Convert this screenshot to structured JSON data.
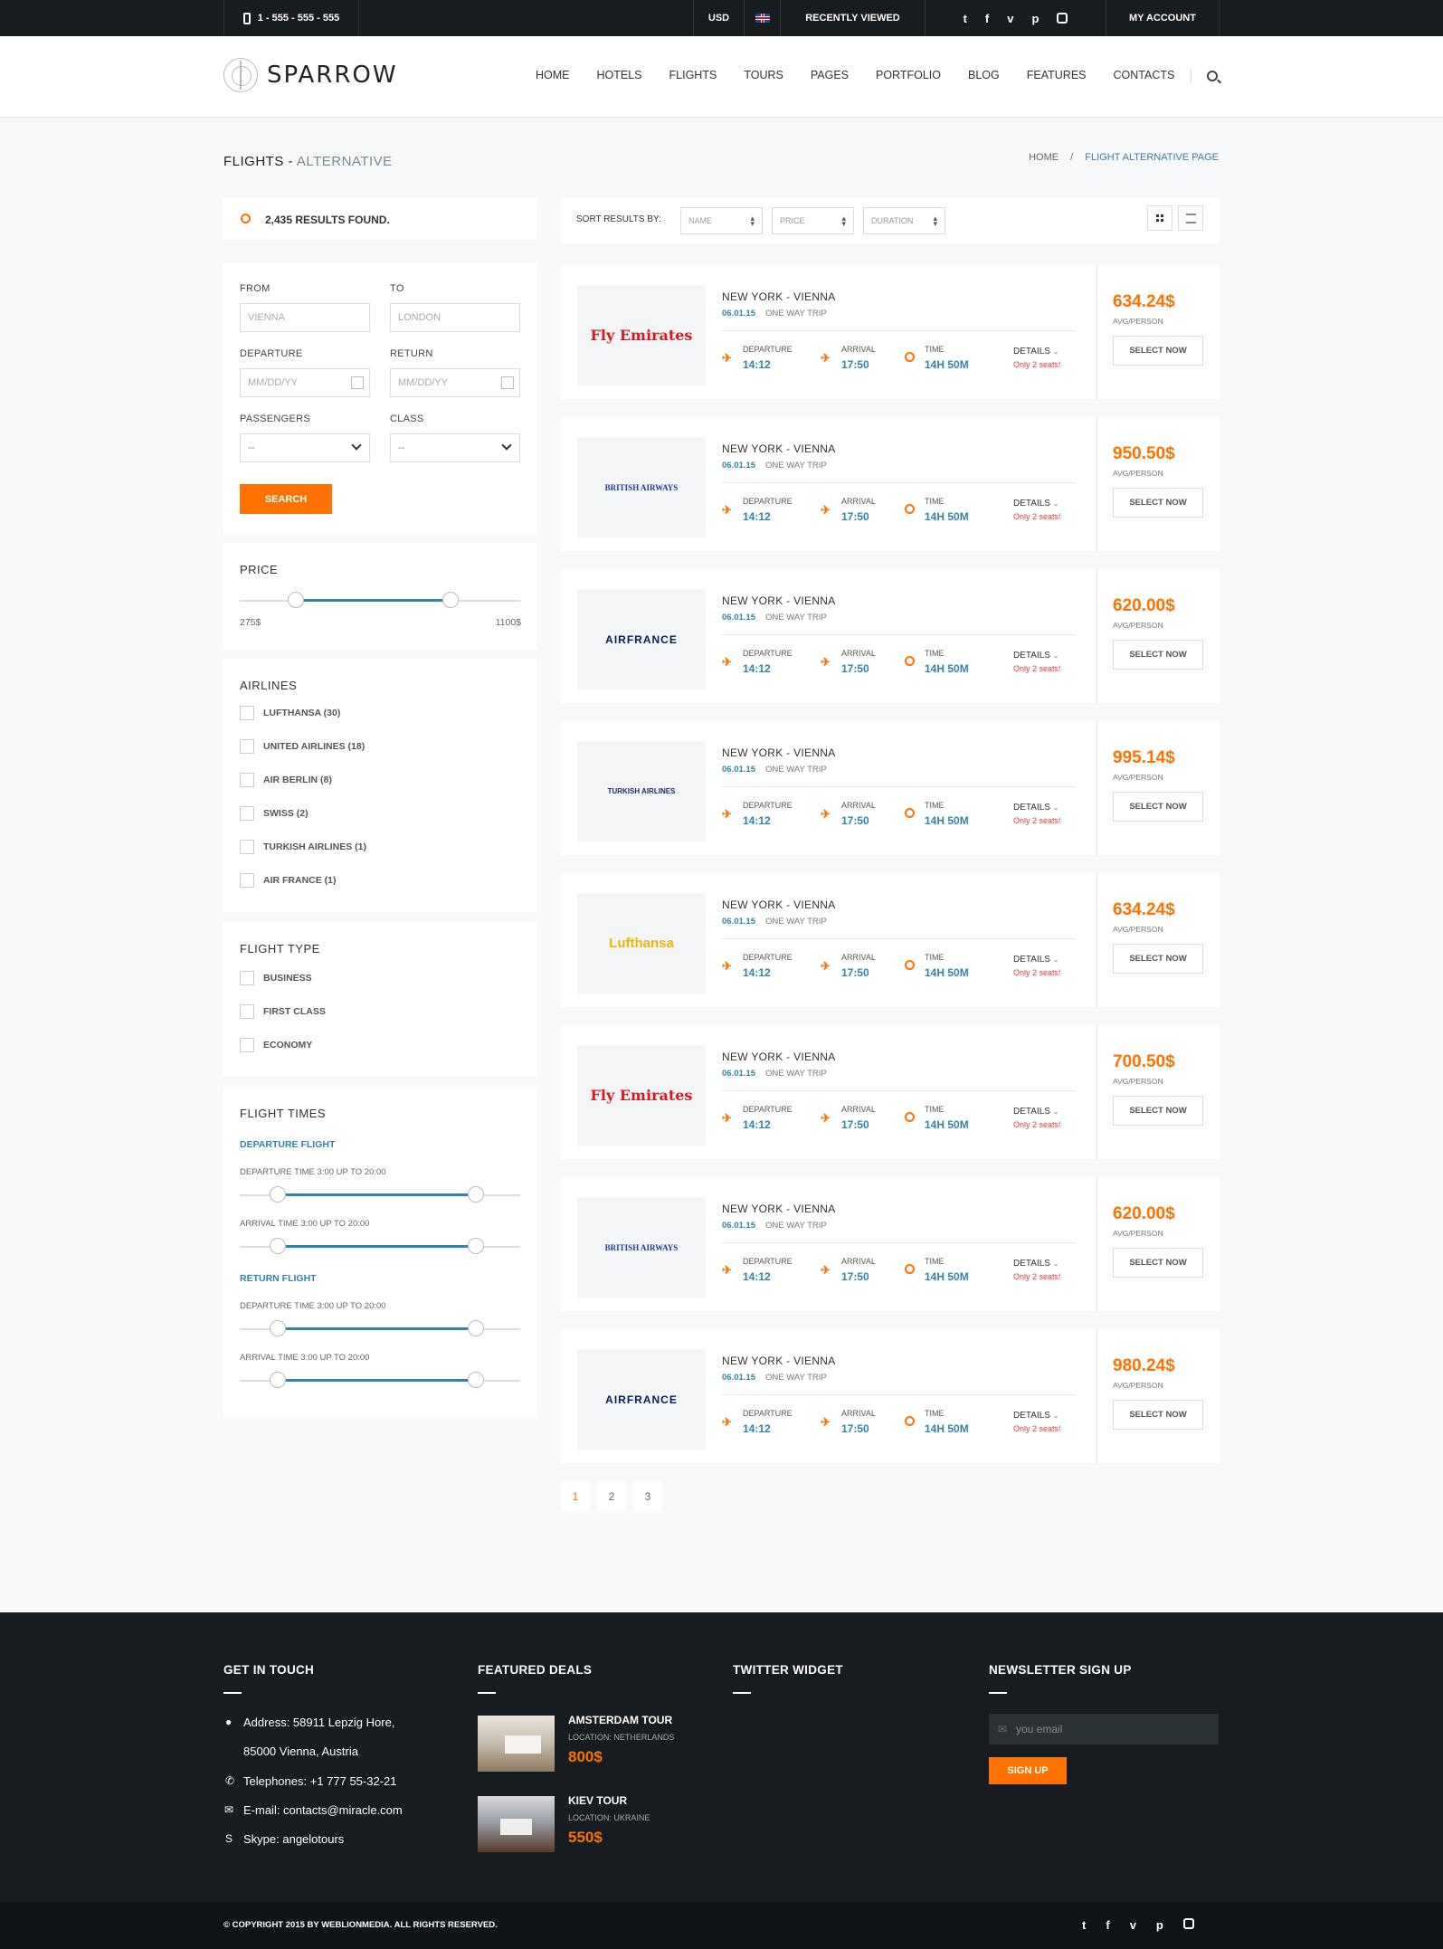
{
  "topbar": {
    "phone": "1 - 555 - 555 - 555",
    "currency": "USD",
    "recently_viewed": "RECENTLY VIEWED",
    "social": [
      "twitter-icon",
      "facebook-icon",
      "vimeo-icon",
      "pinterest-icon",
      "instagram-icon"
    ],
    "account": "MY ACCOUNT"
  },
  "header": {
    "brand": "SPARROW",
    "nav": [
      "HOME",
      "HOTELS",
      "FLIGHTS",
      "TOURS",
      "PAGES",
      "PORTFOLIO",
      "BLOG",
      "FEATURES",
      "CONTACTS"
    ]
  },
  "page": {
    "title_main": "FLIGHTS -",
    "title_alt": "ALTERNATIVE",
    "breadcrumb_home": "HOME",
    "breadcrumb_sep": "/",
    "breadcrumb_current": "FLIGHT ALTERNATIVE PAGE"
  },
  "results": {
    "count_text": "2,435 RESULTS FOUND."
  },
  "search_form": {
    "from_label": "FROM",
    "from_placeholder": "VIENNA",
    "to_label": "TO",
    "to_placeholder": "LONDON",
    "departure_label": "DEPARTURE",
    "departure_placeholder": "MM/DD/YY",
    "return_label": "RETURN",
    "return_placeholder": "MM/DD/YY",
    "passengers_label": "PASSENGERS",
    "passengers_value": "--",
    "class_label": "CLASS",
    "class_value": "--",
    "search_button": "SEARCH"
  },
  "price_filter": {
    "title": "PRICE",
    "min": "275$",
    "max": "1100$",
    "range_start_pct": 20,
    "range_end_pct": 75
  },
  "airlines_filter": {
    "title": "AIRLINES",
    "items": [
      "LUFTHANSA (30)",
      "UNITED AIRLINES (18)",
      "AIR BERLIN (8)",
      "SWISS (2)",
      "TURKISH AIRLINES (1)",
      "AIR FRANCE (1)"
    ]
  },
  "flight_type_filter": {
    "title": "FLIGHT TYPE",
    "items": [
      "BUSINESS",
      "FIRST CLASS",
      "ECONOMY"
    ]
  },
  "flight_times": {
    "title": "FLIGHT TIMES",
    "departure_flight": "DEPARTURE FLIGHT",
    "return_flight": "RETURN FLIGHT",
    "departure_time": "DEPARTURE TIME 3:00 UP TO 20:00",
    "arrival_time": "ARRIVAL TIME 3:00 UP TO 20:00"
  },
  "sort": {
    "label": "SORT RESULTS BY:",
    "options": [
      "NAME",
      "PRICE",
      "DURATION"
    ]
  },
  "flights": [
    {
      "airline": "Fly Emirates",
      "route": "NEW YORK - VIENNA",
      "date": "06.01.15",
      "trip": "ONE WAY TRIP",
      "departure": "14:12",
      "arrival": "17:50",
      "time": "14H 50M",
      "seats": "Only 2 seats!",
      "price": "634.24$"
    },
    {
      "airline": "BRITISH AIRWAYS",
      "route": "NEW YORK - VIENNA",
      "date": "06.01.15",
      "trip": "ONE WAY TRIP",
      "departure": "14:12",
      "arrival": "17:50",
      "time": "14H 50M",
      "seats": "Only 2 seats!",
      "price": "950.50$"
    },
    {
      "airline": "AIRFRANCE",
      "route": "NEW YORK - VIENNA",
      "date": "06.01.15",
      "trip": "ONE WAY TRIP",
      "departure": "14:12",
      "arrival": "17:50",
      "time": "14H 50M",
      "seats": "Only 2 seats!",
      "price": "620.00$"
    },
    {
      "airline": "TURKISH AIRLINES",
      "route": "NEW YORK - VIENNA",
      "date": "06.01.15",
      "trip": "ONE WAY TRIP",
      "departure": "14:12",
      "arrival": "17:50",
      "time": "14H 50M",
      "seats": "Only 2 seats!",
      "price": "995.14$"
    },
    {
      "airline": "Lufthansa",
      "route": "NEW YORK - VIENNA",
      "date": "06.01.15",
      "trip": "ONE WAY TRIP",
      "departure": "14:12",
      "arrival": "17:50",
      "time": "14H 50M",
      "seats": "Only 2 seats!",
      "price": "634.24$"
    },
    {
      "airline": "Fly Emirates",
      "route": "NEW YORK - VIENNA",
      "date": "06.01.15",
      "trip": "ONE WAY TRIP",
      "departure": "14:12",
      "arrival": "17:50",
      "time": "14H 50M",
      "seats": "Only 2 seats!",
      "price": "700.50$"
    },
    {
      "airline": "BRITISH AIRWAYS",
      "route": "NEW YORK - VIENNA",
      "date": "06.01.15",
      "trip": "ONE WAY TRIP",
      "departure": "14:12",
      "arrival": "17:50",
      "time": "14H 50M",
      "seats": "Only 2 seats!",
      "price": "620.00$"
    },
    {
      "airline": "AIRFRANCE",
      "route": "NEW YORK - VIENNA",
      "date": "06.01.15",
      "trip": "ONE WAY TRIP",
      "departure": "14:12",
      "arrival": "17:50",
      "time": "14H 50M",
      "seats": "Only 2 seats!",
      "price": "980.24$"
    }
  ],
  "flight_labels": {
    "departure": "DEPARTURE",
    "arrival": "ARRIVAL",
    "time": "TIME",
    "details": "DETAILS",
    "avg": "AVG/PERSON",
    "select": "SELECT NOW"
  },
  "pagination": [
    "1",
    "2",
    "3"
  ],
  "footer": {
    "contact_title": "GET IN TOUCH",
    "address_1": "Address: 58911 Lepzig Hore,",
    "address_2": "85000 Vienna, Austria",
    "phone": "Telephones: +1 777 55-32-21",
    "email": "E-mail: contacts@miracle.com",
    "skype": "Skype: angelotours",
    "deals_title": "FEATURED DEALS",
    "deals": [
      {
        "name": "AMSTERDAM TOUR",
        "location": "LOCATION: NETHERLANDS",
        "price": "800$"
      },
      {
        "name": "KIEV TOUR",
        "location": "LOCATION: UKRAINE",
        "price": "550$"
      }
    ],
    "twitter_title": "TWITTER WIDGET",
    "newsletter_title": "NEWSLETTER SIGN UP",
    "email_placeholder": "you email",
    "signup_button": "SIGN UP",
    "copyright": "© COPYRIGHT 2015 BY WEBLIONMEDIA. ALL RIGHTS RESERVED."
  },
  "colors": {
    "accent": "#ff7200",
    "blue": "#2f84a8",
    "dark": "#161c1f"
  }
}
